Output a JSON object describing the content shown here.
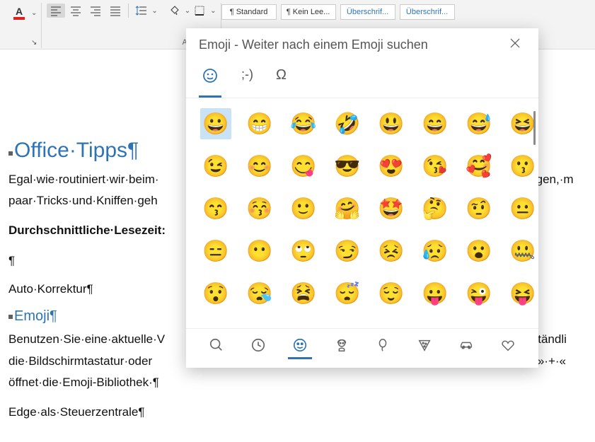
{
  "ribbon": {
    "group_paragraph_label": "Absatz",
    "styles": [
      "¶ Standard",
      "¶ Kein Lee...",
      "Überschrif...",
      "Überschrif..."
    ]
  },
  "doc": {
    "h1": "Office·Tipps¶",
    "p1": "Egal·wie·routiniert·wir·beim·",
    "p1b": "mögen,·m",
    "p2": "paar·Tricks·und·Kniffen·geh",
    "b1": "Durchschnittliche·Lesezeit:",
    "blank": "¶",
    "p3": "Auto·Korrektur¶",
    "h2": "Emoji¶",
    "p4": "Benutzen·Sie·eine·aktuelle·V",
    "p4b": "mständli",
    "p5": "die·Bildschirmtastatur·oder",
    "p5b": "ows»·+·«",
    "p6": "öffnet·die·Emoji-Bibliothek·¶",
    "p7": "Edge·als·Steuerzentrale¶"
  },
  "panel": {
    "title": "Emoji - Weiter nach einem Emoji suchen",
    "tabs": {
      "emoji": "☺",
      "kaomoji": ";-)",
      "symbols": "Ω"
    },
    "emojis": [
      "😀",
      "😁",
      "😂",
      "🤣",
      "😃",
      "😄",
      "😅",
      "😆",
      "😉",
      "😊",
      "😋",
      "😎",
      "😍",
      "😘",
      "🥰",
      "😗",
      "😙",
      "😚",
      "🙂",
      "🤗",
      "🤩",
      "🤔",
      "🤨",
      "😐",
      "😑",
      "😶",
      "🙄",
      "😏",
      "😣",
      "😥",
      "😮",
      "🤐",
      "😯",
      "😪",
      "😫",
      "😴",
      "😌",
      "😛",
      "😜",
      "😝"
    ],
    "categories": [
      "search",
      "recent",
      "smiley",
      "people",
      "balloon",
      "pizza",
      "car",
      "heart"
    ]
  }
}
